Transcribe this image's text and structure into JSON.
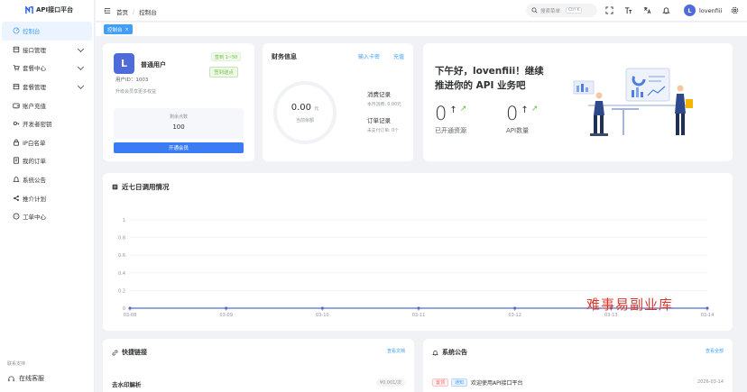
{
  "app": {
    "title": "API接口平台"
  },
  "sidebar": {
    "items": [
      {
        "label": "控制台",
        "icon": "dashboard-icon",
        "active": true,
        "expandable": false
      },
      {
        "label": "接口管理",
        "icon": "interface-icon",
        "active": false,
        "expandable": true
      },
      {
        "label": "套餐中心",
        "icon": "cart-icon",
        "active": false,
        "expandable": true
      },
      {
        "label": "套餐管理",
        "icon": "package-icon",
        "active": false,
        "expandable": true
      },
      {
        "label": "账户充值",
        "icon": "wallet-icon",
        "active": false,
        "expandable": false
      },
      {
        "label": "开发者密钥",
        "icon": "key-icon",
        "active": false,
        "expandable": false
      },
      {
        "label": "IP白名单",
        "icon": "lock-icon",
        "active": false,
        "expandable": false
      },
      {
        "label": "我的订单",
        "icon": "order-icon",
        "active": false,
        "expandable": false
      },
      {
        "label": "系统公告",
        "icon": "bell-icon",
        "active": false,
        "expandable": false
      },
      {
        "label": "推介计划",
        "icon": "share-icon",
        "active": false,
        "expandable": false
      },
      {
        "label": "工单中心",
        "icon": "chat-icon",
        "active": false,
        "expandable": false
      }
    ],
    "footer_label": "联系支持",
    "service_label": "在线客服"
  },
  "header": {
    "breadcrumb": [
      "首页",
      "控制台"
    ],
    "search_placeholder": "搜索菜单",
    "search_shortcut": "Ctrl K",
    "username": "lovenfiii",
    "avatar_letter": "L"
  },
  "tags": {
    "active": "控制台"
  },
  "user_card": {
    "avatar_letter": "L",
    "level": "普通用户",
    "badge": "签到 1~50",
    "checkin_label": "签到送点",
    "user_id": "用户ID：1003",
    "hint": "升级会员享更多权益",
    "balance_label": "剩余点数",
    "balance_value": "100",
    "upgrade_label": "开通会员"
  },
  "finance": {
    "title": "财务信息",
    "link_card": "输入卡密",
    "link_recharge": "充值",
    "balance": "0.00",
    "unit": "元",
    "balance_label": "当前余额",
    "consume_title": "消费记录",
    "consume_sub": "本月消费: 0.00元",
    "order_title": "订单记录",
    "order_sub": "未支付订单: 0个"
  },
  "welcome": {
    "line1": "下午好，lovenfiii！继续",
    "line2": "推进你的 API 业务吧",
    "resources_value": "0",
    "resources_label": "已开通资源",
    "api_value": "0",
    "api_label": "API数量"
  },
  "chart": {
    "title": "近七日调用情况"
  },
  "chart_data": {
    "type": "line",
    "x": [
      "03-08",
      "03-09",
      "03-10",
      "03-11",
      "03-12",
      "03-13",
      "03-14"
    ],
    "series": [
      {
        "values": [
          0,
          0,
          0,
          0,
          0,
          0,
          0
        ],
        "color": "#5470c6"
      }
    ],
    "ylim": [
      0,
      1
    ],
    "yticks": [
      "0",
      "0.2",
      "0.4",
      "0.6",
      "0.8",
      "1"
    ],
    "grid": true
  },
  "quick": {
    "title": "快捷链接",
    "more": "查看文档",
    "item_label": "去水印解析",
    "item_price": "¥0.001/次"
  },
  "notice": {
    "title": "系统公告",
    "more": "查看全部",
    "tag_pinned": "置顶",
    "tag_type": "通知",
    "text": "欢迎使用API接口平台",
    "date": "2026-03-14"
  },
  "watermark": "难事易副业库"
}
